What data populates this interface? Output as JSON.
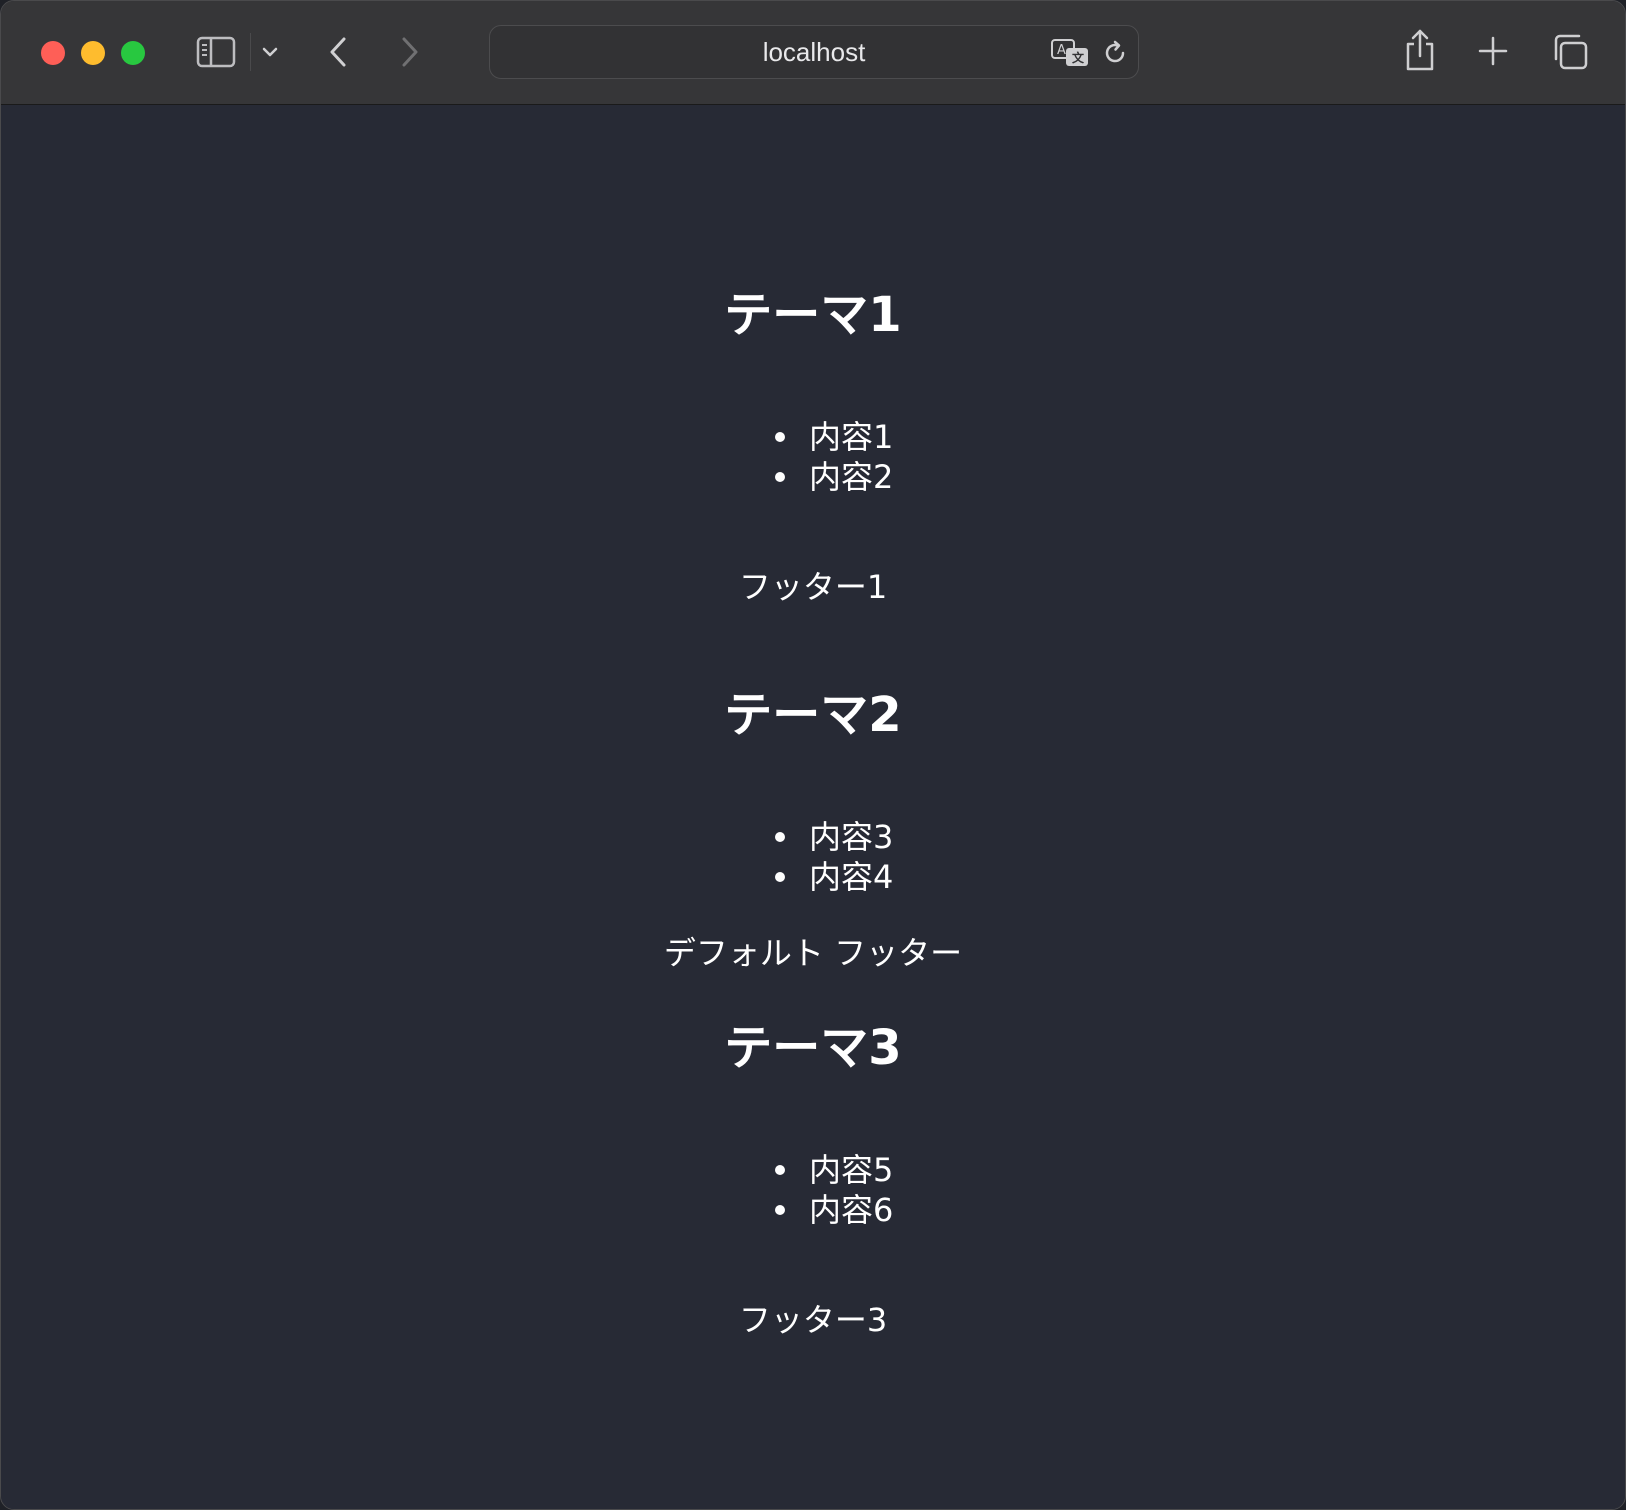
{
  "browser": {
    "url": "localhost",
    "colors": {
      "close": "#fe5f57",
      "minimize": "#febc2e",
      "maximize": "#28c840"
    },
    "icons": {
      "sidebar": "sidebar-icon",
      "tab_group_menu": "chevron-down-icon",
      "back": "chevron-left-icon",
      "forward": "chevron-right-icon",
      "translate": "translate-icon",
      "reload": "reload-icon",
      "share": "share-icon",
      "new_tab": "plus-icon",
      "tab_overview": "tabs-icon"
    }
  },
  "page": {
    "background": "#272a35",
    "sections": [
      {
        "title": "テーマ1",
        "items": [
          "内容1",
          "内容2"
        ],
        "footer": "フッター1"
      },
      {
        "title": "テーマ2",
        "items": [
          "内容3",
          "内容4"
        ],
        "footer": "デフォルト フッター"
      },
      {
        "title": "テーマ3",
        "items": [
          "内容5",
          "内容6"
        ],
        "footer": "フッター3"
      }
    ]
  }
}
